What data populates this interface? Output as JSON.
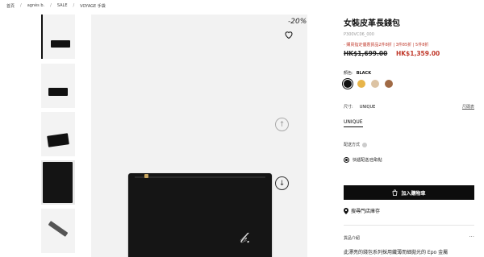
{
  "breadcrumb": [
    "首頁",
    "agnès b.",
    "SALE",
    "VOYAGE 手袋"
  ],
  "breadcrumb_sep": "/",
  "gallery": {
    "discount_badge": "-20%",
    "thumb_count": 5
  },
  "product": {
    "title": "女裝皮革長錢包",
    "sku": "P300VC06_000",
    "promo": "- 購買指定優惠貨品2件8折 | 3件85折 | 5件8折",
    "price_old": "HK$1,699.00",
    "price_new": "HK$1,359.00"
  },
  "color": {
    "label": "顏色:",
    "selected": "BLACK",
    "swatches": [
      "#111111",
      "#e8b54a",
      "#dcc3a3",
      "#a06a45"
    ]
  },
  "size": {
    "label": "尺寸:",
    "value": "UNIQUE",
    "guide": "尺碼表",
    "option": "UNIQUE"
  },
  "shipping": {
    "label": "配送方式",
    "option": "快遞配送/自取點"
  },
  "actions": {
    "add_to_cart": "加入購物車",
    "find_store": "搜尋門店庫存"
  },
  "intro": {
    "heading": "貨品介紹",
    "more": "···",
    "text": "此漂亮的錢包系列採用纖薄而細拋光的 Epo 金屬"
  }
}
